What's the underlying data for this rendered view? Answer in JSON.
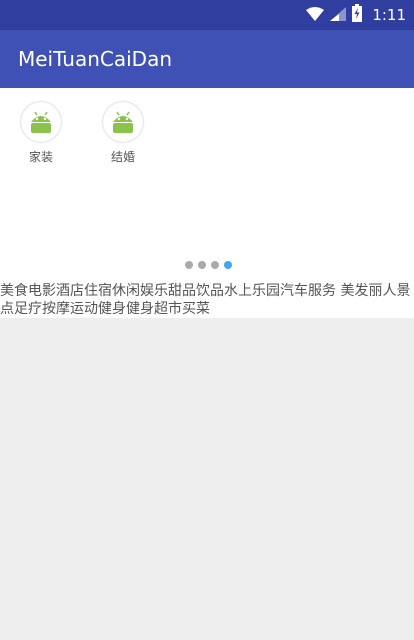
{
  "status_bar": {
    "time": "1:11",
    "icons": [
      "wifi-icon",
      "signal-icon",
      "battery-icon"
    ]
  },
  "app_bar": {
    "title": "MeiTuanCaiDan",
    "color": "#3f51b5",
    "status_color": "#303f9f"
  },
  "categories": [
    {
      "label": "家装",
      "icon": "android-icon"
    },
    {
      "label": "结婚",
      "icon": "android-icon"
    }
  ],
  "pager": {
    "page_count": 4,
    "active_index": 3,
    "active_color": "#42a5f5",
    "inactive_color": "#aaaaaa"
  },
  "category_text": "美食电影酒店住宿休闲娱乐甜品饮品水上乐园汽车服务 美发丽人景点足疗按摩运动健身健身超市买菜"
}
